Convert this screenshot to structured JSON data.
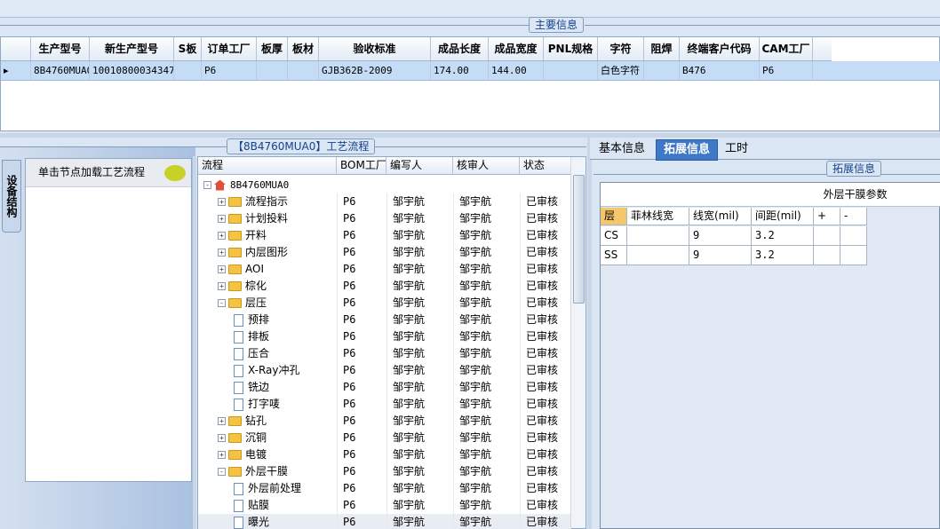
{
  "main_info": {
    "caption": "主要信息",
    "columns": [
      "生产型号",
      "新生产型号",
      "S板",
      "订单工厂",
      "板厚",
      "板材",
      "验收标准",
      "成品长度",
      "成品宽度",
      "PNL规格",
      "字符",
      "阻焊",
      "终端客户代码",
      "CAM工厂"
    ],
    "row": [
      "8B4760MUA0",
      "10010800034347",
      "",
      "P6",
      "",
      "",
      "GJB362B-2009",
      "174.00",
      "144.00",
      "",
      "白色字符",
      "",
      "B476",
      "P6"
    ]
  },
  "left_panel": {
    "vertical_tab": "设备结构",
    "hint": "单击节点加载工艺流程"
  },
  "process_panel": {
    "caption": "【8B4760MUA0】工艺流程",
    "columns": [
      "流程",
      "BOM工厂",
      "编写人",
      "核审人",
      "状态"
    ],
    "root": "8B4760MUA0",
    "rows": [
      {
        "name": "流程指示",
        "kind": "folder",
        "level": 1,
        "expand": "+",
        "factory": "P6",
        "writer": "邹宇航",
        "reviewer": "邹宇航",
        "status": "已审核"
      },
      {
        "name": "计划投料",
        "kind": "folder",
        "level": 1,
        "expand": "+",
        "factory": "P6",
        "writer": "邹宇航",
        "reviewer": "邹宇航",
        "status": "已审核"
      },
      {
        "name": "开料",
        "kind": "folder",
        "level": 1,
        "expand": "+",
        "factory": "P6",
        "writer": "邹宇航",
        "reviewer": "邹宇航",
        "status": "已审核"
      },
      {
        "name": "内层图形",
        "kind": "folder",
        "level": 1,
        "expand": "+",
        "factory": "P6",
        "writer": "邹宇航",
        "reviewer": "邹宇航",
        "status": "已审核"
      },
      {
        "name": "AOI",
        "kind": "folder",
        "level": 1,
        "expand": "+",
        "factory": "P6",
        "writer": "邹宇航",
        "reviewer": "邹宇航",
        "status": "已审核"
      },
      {
        "name": "棕化",
        "kind": "folder",
        "level": 1,
        "expand": "+",
        "factory": "P6",
        "writer": "邹宇航",
        "reviewer": "邹宇航",
        "status": "已审核"
      },
      {
        "name": "层压",
        "kind": "folder",
        "level": 1,
        "expand": "-",
        "factory": "P6",
        "writer": "邹宇航",
        "reviewer": "邹宇航",
        "status": "已审核"
      },
      {
        "name": "预排",
        "kind": "doc",
        "level": 2,
        "expand": "",
        "factory": "P6",
        "writer": "邹宇航",
        "reviewer": "邹宇航",
        "status": "已审核"
      },
      {
        "name": "排板",
        "kind": "doc",
        "level": 2,
        "expand": "",
        "factory": "P6",
        "writer": "邹宇航",
        "reviewer": "邹宇航",
        "status": "已审核"
      },
      {
        "name": "压合",
        "kind": "doc",
        "level": 2,
        "expand": "",
        "factory": "P6",
        "writer": "邹宇航",
        "reviewer": "邹宇航",
        "status": "已审核"
      },
      {
        "name": "X-Ray冲孔",
        "kind": "doc",
        "level": 2,
        "expand": "",
        "factory": "P6",
        "writer": "邹宇航",
        "reviewer": "邹宇航",
        "status": "已审核"
      },
      {
        "name": "铣边",
        "kind": "doc",
        "level": 2,
        "expand": "",
        "factory": "P6",
        "writer": "邹宇航",
        "reviewer": "邹宇航",
        "status": "已审核"
      },
      {
        "name": "打字唛",
        "kind": "doc",
        "level": 2,
        "expand": "",
        "factory": "P6",
        "writer": "邹宇航",
        "reviewer": "邹宇航",
        "status": "已审核"
      },
      {
        "name": "钻孔",
        "kind": "folder",
        "level": 1,
        "expand": "+",
        "factory": "P6",
        "writer": "邹宇航",
        "reviewer": "邹宇航",
        "status": "已审核"
      },
      {
        "name": "沉铜",
        "kind": "folder",
        "level": 1,
        "expand": "+",
        "factory": "P6",
        "writer": "邹宇航",
        "reviewer": "邹宇航",
        "status": "已审核"
      },
      {
        "name": "电镀",
        "kind": "folder",
        "level": 1,
        "expand": "+",
        "factory": "P6",
        "writer": "邹宇航",
        "reviewer": "邹宇航",
        "status": "已审核"
      },
      {
        "name": "外层干膜",
        "kind": "folder",
        "level": 1,
        "expand": "-",
        "factory": "P6",
        "writer": "邹宇航",
        "reviewer": "邹宇航",
        "status": "已审核"
      },
      {
        "name": "外层前处理",
        "kind": "doc",
        "level": 2,
        "expand": "",
        "factory": "P6",
        "writer": "邹宇航",
        "reviewer": "邹宇航",
        "status": "已审核"
      },
      {
        "name": "贴膜",
        "kind": "doc",
        "level": 2,
        "expand": "",
        "factory": "P6",
        "writer": "邹宇航",
        "reviewer": "邹宇航",
        "status": "已审核"
      },
      {
        "name": "曝光",
        "kind": "doc",
        "level": 2,
        "expand": "",
        "factory": "P6",
        "writer": "邹宇航",
        "reviewer": "邹宇航",
        "status": "已审核"
      }
    ]
  },
  "right_panel": {
    "tabs": [
      "基本信息",
      "拓展信息",
      "工时"
    ],
    "active_tab": "拓展信息",
    "caption": "拓展信息",
    "grid_title": "外层干膜参数",
    "columns": [
      "层",
      "菲林线宽",
      "线宽(mil)",
      "间距(mil)",
      "+",
      "-"
    ],
    "rows": [
      [
        "CS",
        "",
        "9",
        "3.2",
        "",
        ""
      ],
      [
        "SS",
        "",
        "9",
        "3.2",
        "",
        ""
      ]
    ]
  }
}
